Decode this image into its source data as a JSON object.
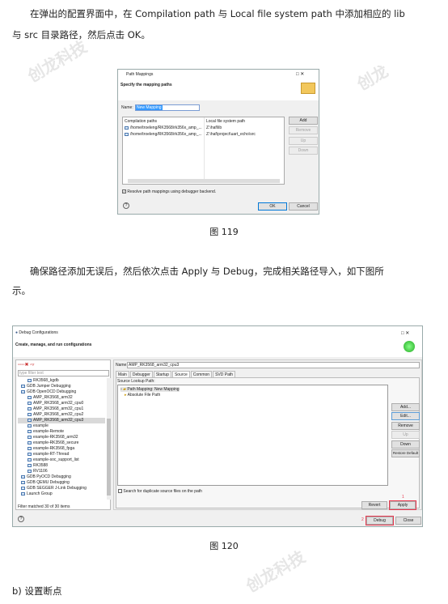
{
  "para1": {
    "line1": "在弹出的配置界面中，在 Compilation path 与 Local file system path 中添加相应的 lib",
    "line2": "与 src 目录路径，然后点击 OK。"
  },
  "fig1": {
    "title": "Path Mappings",
    "header": "Specify the mapping paths",
    "name_label": "Name:",
    "name_value": "New Mapping",
    "columns": [
      "Compilation paths",
      "Local file system path"
    ],
    "rows": [
      [
        "/home/troeleng/RK3568/rk356x_amp_...",
        "Z:\\haf\\lib"
      ],
      [
        "/home/troeleng/RK3568/rk356x_amp_...",
        "Z:\\haf\\project\\uart_echo\\src"
      ]
    ],
    "buttons": [
      "Add",
      "Remove",
      "Up",
      "Down"
    ],
    "checkbox": "Resolve path mappings using debugger backend.",
    "checked": true,
    "ok": "OK",
    "cancel": "Cancel",
    "caption": "图 119"
  },
  "para2": {
    "line1": "确保路径添加无误后，然后依次点击 Apply 与 Debug，完成相关路径导入，如下图所",
    "line2": "示。"
  },
  "fig2": {
    "title": "Debug Configurations",
    "header": "Create, manage, and run configurations",
    "filter_placeholder": "type filter text",
    "tree": [
      {
        "label": "RK3568_kgdb",
        "level": 2
      },
      {
        "label": "GDB Jumper Debugging",
        "level": 1
      },
      {
        "label": "GDB OpenOCD Debugging",
        "level": 1
      },
      {
        "label": "AMP_RK3568_arm32",
        "level": 2
      },
      {
        "label": "AMP_RK3568_arm32_cpu0",
        "level": 2
      },
      {
        "label": "AMP_RK3568_arm32_cpu1",
        "level": 2
      },
      {
        "label": "AMP_RK3568_arm32_cpu2",
        "level": 2
      },
      {
        "label": "AMP_RK3568_arm32_cpu3",
        "level": 2,
        "selected": true
      },
      {
        "label": "example",
        "level": 2
      },
      {
        "label": "example-Remote",
        "level": 2
      },
      {
        "label": "example-RK3568_arm32",
        "level": 2
      },
      {
        "label": "example-RK3568_secure",
        "level": 2
      },
      {
        "label": "example-RK3568_fpga",
        "level": 2
      },
      {
        "label": "example-RT-Thread",
        "level": 2
      },
      {
        "label": "example-soc_support_list",
        "level": 2
      },
      {
        "label": "RK3588",
        "level": 2
      },
      {
        "label": "RV1106",
        "level": 2
      },
      {
        "label": "GDB PyOCD Debugging",
        "level": 1
      },
      {
        "label": "GDB QEMU Debugging",
        "level": 1
      },
      {
        "label": "GDB SEGGER J-Link Debugging",
        "level": 1
      },
      {
        "label": "Launch Group",
        "level": 1
      }
    ],
    "filter_status": "Filter matched 30 of 30 items",
    "name_label": "Name:",
    "name_value": "AMP_RK3568_arm32_cpu3",
    "tabs": [
      "Main",
      "Debugger",
      "Startup",
      "Source",
      "Common",
      "SVD Path"
    ],
    "active_tab": "Source",
    "source_label": "Source Lookup Path:",
    "source_items": [
      "Path Mapping: New Mapping",
      "Absolute File Path"
    ],
    "side_buttons": [
      "Add...",
      "Edit...",
      "Remove",
      "Up",
      "Down",
      "Restore Default"
    ],
    "dup_checkbox": "Search for duplicate source files on the path",
    "revert": "Revert",
    "apply": "Apply",
    "debug": "Debug",
    "close": "Close",
    "mark1": "1",
    "mark2": "2",
    "caption": "图 120"
  },
  "section": "b)   设置断点",
  "colors": {
    "highlight": "#3399ff",
    "annotation": "#e8384f"
  }
}
